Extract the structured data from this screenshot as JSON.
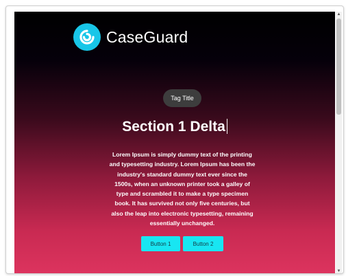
{
  "brand": {
    "name": "CaseGuard",
    "logo_color": "#18c6e8"
  },
  "tag": {
    "label": "Tag Title"
  },
  "section": {
    "title": "Section 1 Delta",
    "body": "Lorem Ipsum is simply dummy text of the printing and typesetting industry. Lorem Ipsum has been the industry's standard dummy text ever since the 1500s, when an unknown printer took a galley of type and scrambled it to make a type specimen book. It has survived not only five centuries, but also the leap into electronic typesetting, remaining essentially unchanged."
  },
  "buttons": {
    "button1_label": "Button 1",
    "button2_label": "Button 2",
    "color": "#18e6f2"
  },
  "colors": {
    "gradient_top": "#000000",
    "gradient_bottom": "#df3560",
    "tag_bg": "#3d3d3d"
  },
  "icons": {
    "logo": "caseguard-logo-icon",
    "scroll_up": "scroll-up-arrow-icon",
    "scroll_down": "scroll-down-arrow-icon"
  }
}
